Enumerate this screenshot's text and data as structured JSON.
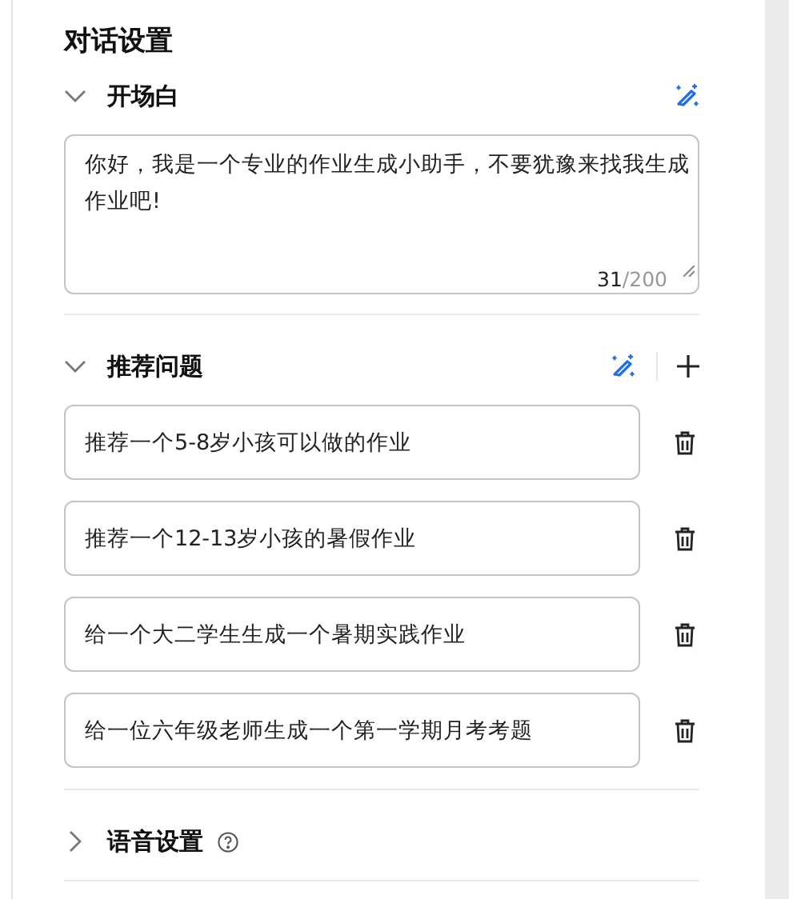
{
  "title": "对话设置",
  "sections": [
    {
      "kind": "opening",
      "title": "开场白",
      "expanded": true,
      "text": "你好，我是一个专业的作业生成小助手，不要犹豫来找我生成作业吧!",
      "count": "31",
      "limit": "/200"
    },
    {
      "kind": "questions",
      "title": "推荐问题",
      "expanded": true,
      "questions": [
        {
          "text": "推荐一个5-8岁小孩可以做的作业"
        },
        {
          "text": "推荐一个12-13岁小孩的暑假作业"
        },
        {
          "text": "给一个大二学生生成一个暑期实践作业"
        },
        {
          "text": "给一位六年级老师生成一个第一学期月考考题"
        }
      ]
    },
    {
      "kind": "voice",
      "title": "语音设置",
      "expanded": false,
      "help": true
    }
  ]
}
